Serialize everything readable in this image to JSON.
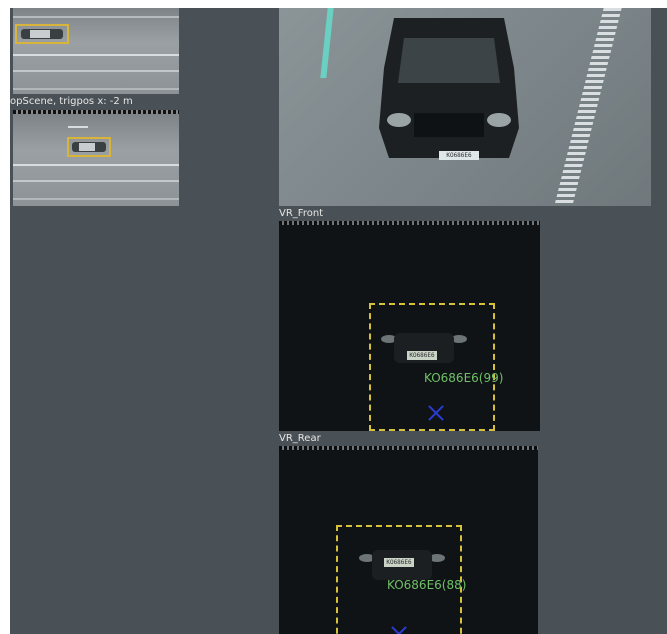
{
  "top_scene": {
    "caption": "opScene, trigpos x: -2 m"
  },
  "front_camera": {
    "title": "VR_Front",
    "plate_text": "KO686E6",
    "ocr_result": "KO686E6(99)"
  },
  "rear_camera": {
    "title": "VR_Rear",
    "plate_text": "KO686E6",
    "ocr_result": "KO686E6(88)"
  },
  "overview_camera": {
    "plate_text": "KO686E6"
  },
  "colors": {
    "background": "#4a5156",
    "detection_box": "#d7c03a",
    "ocr_text": "#6fbf66",
    "trigger_marker": "#2b3bd6"
  },
  "icons": [
    "car-thumbnail-icon",
    "trigger-cross-icon"
  ]
}
